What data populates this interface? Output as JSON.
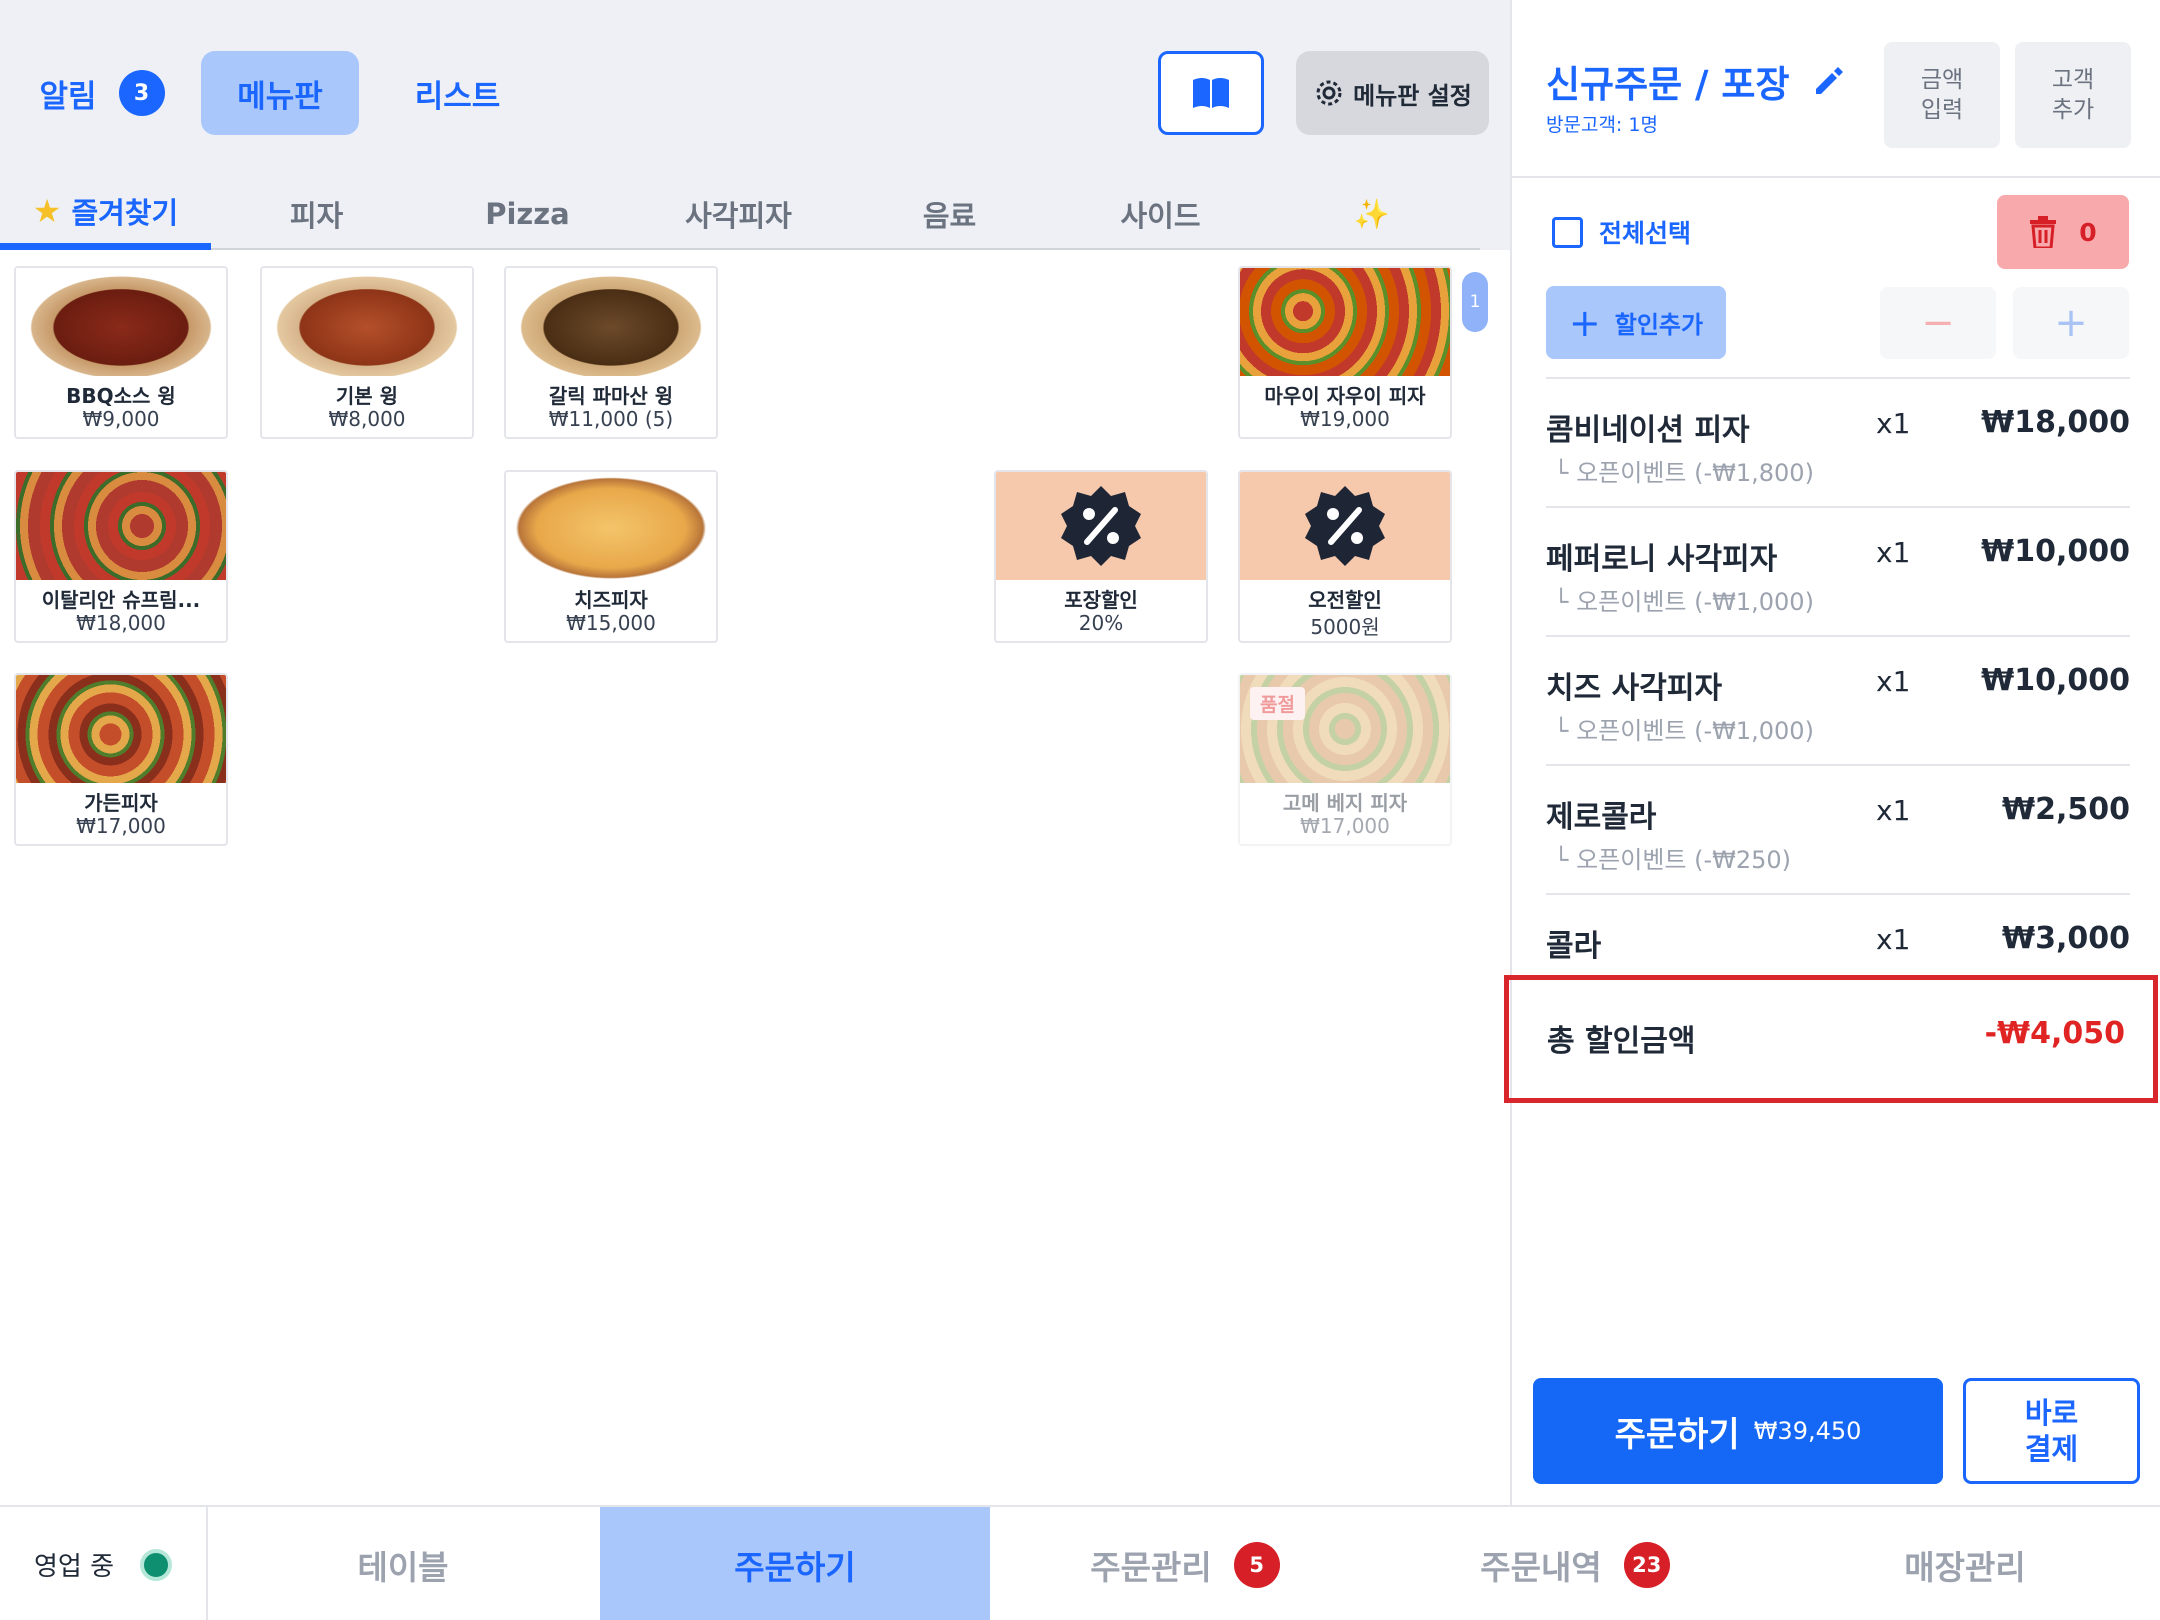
{
  "topbar": {
    "alarm_label": "알림",
    "alarm_count": "3",
    "menuboard_label": "메뉴판",
    "list_label": "리스트",
    "settings_label": "메뉴판 설정"
  },
  "categories": [
    "즐겨찾기",
    "피자",
    "Pizza",
    "사각피자",
    "음료",
    "사이드",
    "✨"
  ],
  "menu_items": [
    {
      "name": "BBQ소스 윙",
      "price": "₩9,000"
    },
    {
      "name": "기본 윙",
      "price": "₩8,000"
    },
    {
      "name": "갈릭 파마산 윙",
      "price": "₩11,000 (5)"
    },
    {
      "name": "마우이 자우이 피자",
      "price": "₩19,000"
    },
    {
      "name": "이탈리안 슈프림...",
      "price": "₩18,000"
    },
    {
      "name": "치즈피자",
      "price": "₩15,000"
    },
    {
      "name": "포장할인",
      "price": "20%"
    },
    {
      "name": "오전할인",
      "price": "5000원"
    },
    {
      "name": "가든피자",
      "price": "₩17,000"
    },
    {
      "name": "고메 베지 피자",
      "price": "₩17,000",
      "tag": "품절"
    }
  ],
  "page_indicator": "1",
  "order": {
    "title": "신규주문 / 포장",
    "visitors": "방문고객: 1명",
    "amount_input": "금액\n입력",
    "add_customer": "고객\n추가",
    "select_all": "전체선택",
    "delete_count": "0",
    "add_discount": "할인추가",
    "minus": "−",
    "plus": "+",
    "items": [
      {
        "name": "콤비네이션 피자",
        "qty": "x1",
        "price": "₩18,000",
        "sub": "└ 오픈이벤트 (-₩1,800)"
      },
      {
        "name": "페퍼로니 사각피자",
        "qty": "x1",
        "price": "₩10,000",
        "sub": "└ 오픈이벤트 (-₩1,000)"
      },
      {
        "name": "치즈 사각피자",
        "qty": "x1",
        "price": "₩10,000",
        "sub": "└ 오픈이벤트 (-₩1,000)"
      },
      {
        "name": "제로콜라",
        "qty": "x1",
        "price": "₩2,500",
        "sub": "└ 오픈이벤트 (-₩250)"
      },
      {
        "name": "콜라",
        "qty": "x1",
        "price": "₩3,000",
        "sub": ""
      }
    ],
    "total_discount_label": "총 할인금액",
    "total_discount_value": "-₩4,050",
    "order_button": "주문하기",
    "order_amount": "₩39,450",
    "pay_now": "바로\n결제"
  },
  "bottom_nav": {
    "status": "영업 중",
    "tabs": [
      {
        "label": "테이블",
        "badge": ""
      },
      {
        "label": "주문하기",
        "badge": ""
      },
      {
        "label": "주문관리",
        "badge": "5"
      },
      {
        "label": "주문내역",
        "badge": "23"
      },
      {
        "label": "매장관리",
        "badge": ""
      }
    ]
  },
  "colors": {
    "accent": "#1a66ff",
    "accent_light": "#a9c7fb",
    "danger": "#d61f26",
    "discount_tile": "#f6c9ad",
    "status_online": "#0e8f6f"
  }
}
